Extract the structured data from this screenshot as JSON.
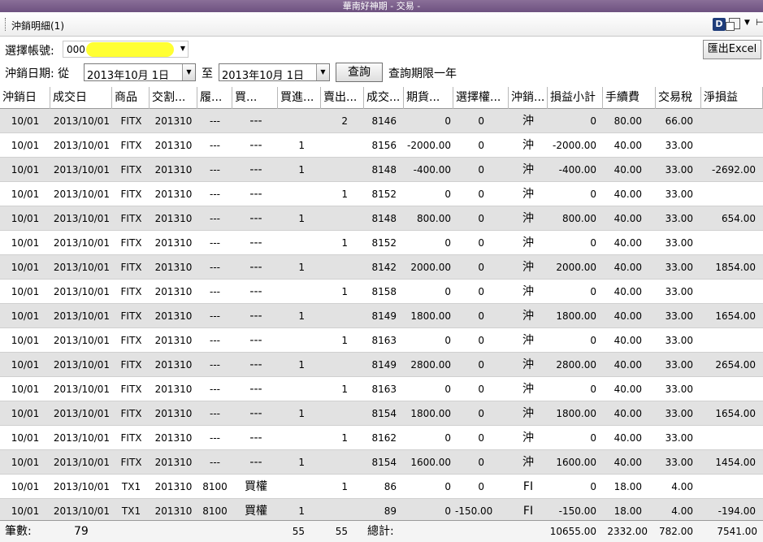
{
  "window": {
    "title": "華南好神期 - 交易 -"
  },
  "panel": {
    "title": "沖銷明細(1)",
    "d_icon": "D"
  },
  "account": {
    "label": "選擇帳號:",
    "value": "000"
  },
  "export_button": "匯出Excel",
  "date_range": {
    "label": "沖銷日期: 從",
    "from": "2013年10月  1日",
    "to_label": "至",
    "to": "2013年10月  1日",
    "query_button": "查詢",
    "note": "查詢期限一年"
  },
  "columns": [
    "沖銷日",
    "成交日",
    "商品",
    "交割...",
    "履...",
    "買...",
    "買進...",
    "賣出...",
    "成交...",
    "期貨...",
    "選擇權...",
    "沖銷...",
    "損益小計",
    "手續費",
    "交易稅",
    "淨損益"
  ],
  "rows": [
    [
      "10/01",
      "2013/10/01",
      "FITX",
      "201310",
      "---",
      "---",
      "",
      "2",
      "8146",
      "0",
      "0",
      "沖",
      "0",
      "80.00",
      "66.00",
      ""
    ],
    [
      "10/01",
      "2013/10/01",
      "FITX",
      "201310",
      "---",
      "---",
      "1",
      "",
      "8156",
      "-2000.00",
      "0",
      "沖",
      "-2000.00",
      "40.00",
      "33.00",
      ""
    ],
    [
      "10/01",
      "2013/10/01",
      "FITX",
      "201310",
      "---",
      "---",
      "1",
      "",
      "8148",
      "-400.00",
      "0",
      "沖",
      "-400.00",
      "40.00",
      "33.00",
      "-2692.00"
    ],
    [
      "10/01",
      "2013/10/01",
      "FITX",
      "201310",
      "---",
      "---",
      "",
      "1",
      "8152",
      "0",
      "0",
      "沖",
      "0",
      "40.00",
      "33.00",
      ""
    ],
    [
      "10/01",
      "2013/10/01",
      "FITX",
      "201310",
      "---",
      "---",
      "1",
      "",
      "8148",
      "800.00",
      "0",
      "沖",
      "800.00",
      "40.00",
      "33.00",
      "654.00"
    ],
    [
      "10/01",
      "2013/10/01",
      "FITX",
      "201310",
      "---",
      "---",
      "",
      "1",
      "8152",
      "0",
      "0",
      "沖",
      "0",
      "40.00",
      "33.00",
      ""
    ],
    [
      "10/01",
      "2013/10/01",
      "FITX",
      "201310",
      "---",
      "---",
      "1",
      "",
      "8142",
      "2000.00",
      "0",
      "沖",
      "2000.00",
      "40.00",
      "33.00",
      "1854.00"
    ],
    [
      "10/01",
      "2013/10/01",
      "FITX",
      "201310",
      "---",
      "---",
      "",
      "1",
      "8158",
      "0",
      "0",
      "沖",
      "0",
      "40.00",
      "33.00",
      ""
    ],
    [
      "10/01",
      "2013/10/01",
      "FITX",
      "201310",
      "---",
      "---",
      "1",
      "",
      "8149",
      "1800.00",
      "0",
      "沖",
      "1800.00",
      "40.00",
      "33.00",
      "1654.00"
    ],
    [
      "10/01",
      "2013/10/01",
      "FITX",
      "201310",
      "---",
      "---",
      "",
      "1",
      "8163",
      "0",
      "0",
      "沖",
      "0",
      "40.00",
      "33.00",
      ""
    ],
    [
      "10/01",
      "2013/10/01",
      "FITX",
      "201310",
      "---",
      "---",
      "1",
      "",
      "8149",
      "2800.00",
      "0",
      "沖",
      "2800.00",
      "40.00",
      "33.00",
      "2654.00"
    ],
    [
      "10/01",
      "2013/10/01",
      "FITX",
      "201310",
      "---",
      "---",
      "",
      "1",
      "8163",
      "0",
      "0",
      "沖",
      "0",
      "40.00",
      "33.00",
      ""
    ],
    [
      "10/01",
      "2013/10/01",
      "FITX",
      "201310",
      "---",
      "---",
      "1",
      "",
      "8154",
      "1800.00",
      "0",
      "沖",
      "1800.00",
      "40.00",
      "33.00",
      "1654.00"
    ],
    [
      "10/01",
      "2013/10/01",
      "FITX",
      "201310",
      "---",
      "---",
      "",
      "1",
      "8162",
      "0",
      "0",
      "沖",
      "0",
      "40.00",
      "33.00",
      ""
    ],
    [
      "10/01",
      "2013/10/01",
      "FITX",
      "201310",
      "---",
      "---",
      "1",
      "",
      "8154",
      "1600.00",
      "0",
      "沖",
      "1600.00",
      "40.00",
      "33.00",
      "1454.00"
    ],
    [
      "10/01",
      "2013/10/01",
      "TX1",
      "201310",
      "8100",
      "買權",
      "",
      "1",
      "86",
      "0",
      "0",
      "FI",
      "0",
      "18.00",
      "4.00",
      ""
    ],
    [
      "10/01",
      "2013/10/01",
      "TX1",
      "201310",
      "8100",
      "買權",
      "1",
      "",
      "89",
      "0",
      "-150.00",
      "FI",
      "-150.00",
      "18.00",
      "4.00",
      "-194.00"
    ]
  ],
  "footer": {
    "count_label": "筆數:",
    "count": "79",
    "buy_total": "55",
    "sell_total": "55",
    "total_label": "總計:",
    "pnl_total": "10655.00",
    "fee_total": "2332.00",
    "tax_total": "782.00",
    "net_total": "7541.00"
  }
}
